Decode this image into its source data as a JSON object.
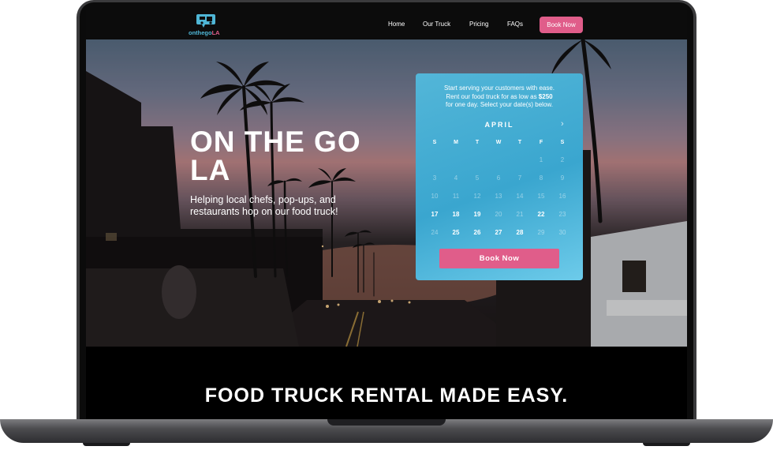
{
  "brand": {
    "name_main": "onthego",
    "name_accent": "LA",
    "accent": "#e05d8a",
    "secondary": "#4fb6d6"
  },
  "nav": {
    "links": [
      "Home",
      "Our Truck",
      "Pricing",
      "FAQs"
    ],
    "cta": "Book Now"
  },
  "hero": {
    "title": "ON THE GO LA",
    "subtitle": "Helping local chefs, pop-ups, and restaurants hop on our food truck!"
  },
  "booking": {
    "intro_line1": "Start serving your customers with ease.",
    "intro_line2_pre": "Rent our food truck for as low as ",
    "price": "$250",
    "intro_line3": "for one day. Select your date(s) below.",
    "month": "APRIL",
    "weekdays": [
      "S",
      "M",
      "T",
      "W",
      "T",
      "F",
      "S"
    ],
    "days": [
      {
        "d": "1",
        "available": false,
        "col": 5,
        "row": 0
      },
      {
        "d": "2",
        "available": false,
        "col": 6,
        "row": 0
      },
      {
        "d": "3",
        "available": false,
        "col": 0,
        "row": 1
      },
      {
        "d": "4",
        "available": false,
        "col": 1,
        "row": 1
      },
      {
        "d": "5",
        "available": false,
        "col": 2,
        "row": 1
      },
      {
        "d": "6",
        "available": false,
        "col": 3,
        "row": 1
      },
      {
        "d": "7",
        "available": false,
        "col": 4,
        "row": 1
      },
      {
        "d": "8",
        "available": false,
        "col": 5,
        "row": 1
      },
      {
        "d": "9",
        "available": false,
        "col": 6,
        "row": 1
      },
      {
        "d": "10",
        "available": false,
        "col": 0,
        "row": 2
      },
      {
        "d": "11",
        "available": false,
        "col": 1,
        "row": 2
      },
      {
        "d": "12",
        "available": false,
        "col": 2,
        "row": 2
      },
      {
        "d": "13",
        "available": false,
        "col": 3,
        "row": 2
      },
      {
        "d": "14",
        "available": false,
        "col": 4,
        "row": 2
      },
      {
        "d": "15",
        "available": false,
        "col": 5,
        "row": 2
      },
      {
        "d": "16",
        "available": false,
        "col": 6,
        "row": 2
      },
      {
        "d": "17",
        "available": true,
        "col": 0,
        "row": 3
      },
      {
        "d": "18",
        "available": true,
        "col": 1,
        "row": 3
      },
      {
        "d": "19",
        "available": true,
        "col": 2,
        "row": 3
      },
      {
        "d": "20",
        "available": false,
        "col": 3,
        "row": 3
      },
      {
        "d": "21",
        "available": false,
        "col": 4,
        "row": 3
      },
      {
        "d": "22",
        "available": true,
        "col": 5,
        "row": 3
      },
      {
        "d": "23",
        "available": false,
        "col": 6,
        "row": 3
      },
      {
        "d": "24",
        "available": false,
        "col": 0,
        "row": 4
      },
      {
        "d": "25",
        "available": true,
        "col": 1,
        "row": 4
      },
      {
        "d": "26",
        "available": true,
        "col": 2,
        "row": 4
      },
      {
        "d": "27",
        "available": true,
        "col": 3,
        "row": 4
      },
      {
        "d": "28",
        "available": true,
        "col": 4,
        "row": 4
      },
      {
        "d": "29",
        "available": false,
        "col": 5,
        "row": 4
      },
      {
        "d": "30",
        "available": false,
        "col": 6,
        "row": 4
      }
    ],
    "cta": "Book Now"
  },
  "section": {
    "title": "FOOD TRUCK RENTAL MADE EASY."
  }
}
